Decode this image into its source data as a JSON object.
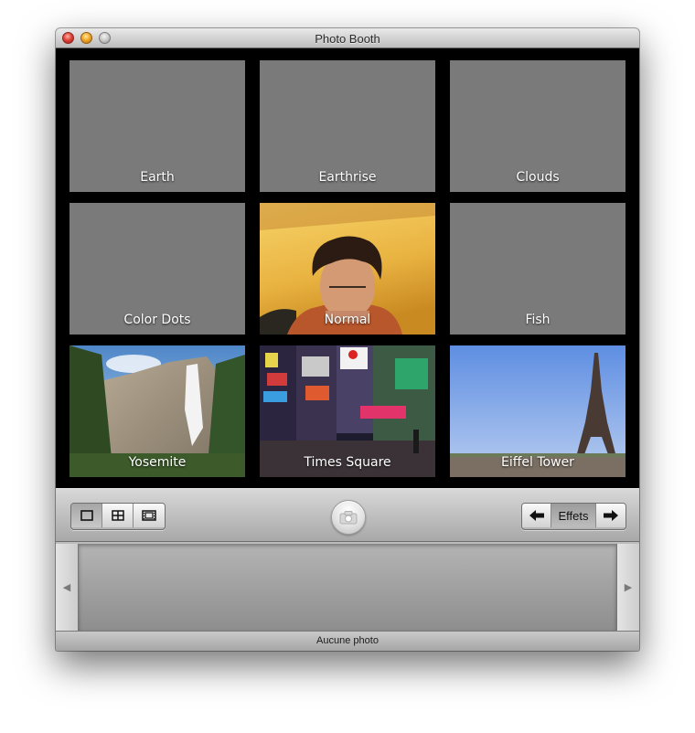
{
  "window": {
    "title": "Photo Booth"
  },
  "effects": [
    {
      "label": "Earth",
      "kind": "blank"
    },
    {
      "label": "Earthrise",
      "kind": "blank"
    },
    {
      "label": "Clouds",
      "kind": "blank"
    },
    {
      "label": "Color Dots",
      "kind": "blank"
    },
    {
      "label": "Normal",
      "kind": "camera"
    },
    {
      "label": "Fish",
      "kind": "blank"
    },
    {
      "label": "Yosemite",
      "kind": "photo"
    },
    {
      "label": "Times Square",
      "kind": "photo"
    },
    {
      "label": "Eiffel Tower",
      "kind": "photo"
    }
  ],
  "toolbar": {
    "view_modes": [
      "single-shot-icon",
      "four-up-icon",
      "filmstrip-icon"
    ],
    "active_view_mode": "single-shot-icon",
    "capture_icon": "camera-icon",
    "effects_label": "Effets",
    "prev_icon": "arrow-left-icon",
    "next_icon": "arrow-right-icon"
  },
  "tray": {
    "left_icon": "triangle-left-icon",
    "right_icon": "triangle-right-icon"
  },
  "status": {
    "text": "Aucune photo"
  },
  "colors": {
    "tile_gray": "#7a7a7a",
    "grid_background": "#000000"
  }
}
